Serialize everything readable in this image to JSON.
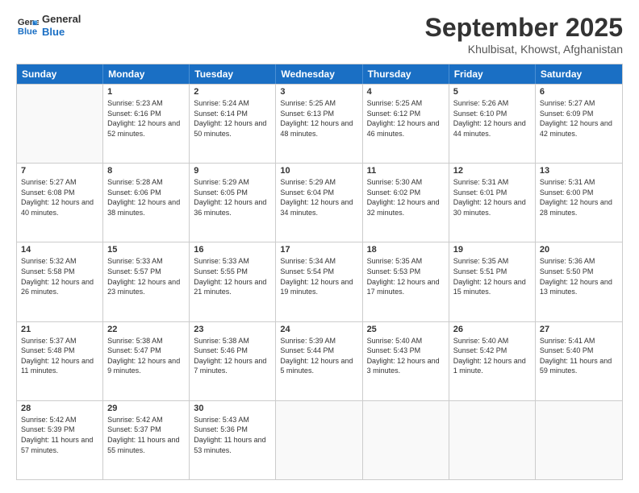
{
  "logo": {
    "line1": "General",
    "line2": "Blue"
  },
  "title": "September 2025",
  "subtitle": "Khulbisat, Khowst, Afghanistan",
  "header_days": [
    "Sunday",
    "Monday",
    "Tuesday",
    "Wednesday",
    "Thursday",
    "Friday",
    "Saturday"
  ],
  "weeks": [
    [
      {
        "day": "",
        "empty": true
      },
      {
        "day": "1",
        "sunrise": "Sunrise: 5:23 AM",
        "sunset": "Sunset: 6:16 PM",
        "daylight": "Daylight: 12 hours and 52 minutes."
      },
      {
        "day": "2",
        "sunrise": "Sunrise: 5:24 AM",
        "sunset": "Sunset: 6:14 PM",
        "daylight": "Daylight: 12 hours and 50 minutes."
      },
      {
        "day": "3",
        "sunrise": "Sunrise: 5:25 AM",
        "sunset": "Sunset: 6:13 PM",
        "daylight": "Daylight: 12 hours and 48 minutes."
      },
      {
        "day": "4",
        "sunrise": "Sunrise: 5:25 AM",
        "sunset": "Sunset: 6:12 PM",
        "daylight": "Daylight: 12 hours and 46 minutes."
      },
      {
        "day": "5",
        "sunrise": "Sunrise: 5:26 AM",
        "sunset": "Sunset: 6:10 PM",
        "daylight": "Daylight: 12 hours and 44 minutes."
      },
      {
        "day": "6",
        "sunrise": "Sunrise: 5:27 AM",
        "sunset": "Sunset: 6:09 PM",
        "daylight": "Daylight: 12 hours and 42 minutes."
      }
    ],
    [
      {
        "day": "7",
        "sunrise": "Sunrise: 5:27 AM",
        "sunset": "Sunset: 6:08 PM",
        "daylight": "Daylight: 12 hours and 40 minutes."
      },
      {
        "day": "8",
        "sunrise": "Sunrise: 5:28 AM",
        "sunset": "Sunset: 6:06 PM",
        "daylight": "Daylight: 12 hours and 38 minutes."
      },
      {
        "day": "9",
        "sunrise": "Sunrise: 5:29 AM",
        "sunset": "Sunset: 6:05 PM",
        "daylight": "Daylight: 12 hours and 36 minutes."
      },
      {
        "day": "10",
        "sunrise": "Sunrise: 5:29 AM",
        "sunset": "Sunset: 6:04 PM",
        "daylight": "Daylight: 12 hours and 34 minutes."
      },
      {
        "day": "11",
        "sunrise": "Sunrise: 5:30 AM",
        "sunset": "Sunset: 6:02 PM",
        "daylight": "Daylight: 12 hours and 32 minutes."
      },
      {
        "day": "12",
        "sunrise": "Sunrise: 5:31 AM",
        "sunset": "Sunset: 6:01 PM",
        "daylight": "Daylight: 12 hours and 30 minutes."
      },
      {
        "day": "13",
        "sunrise": "Sunrise: 5:31 AM",
        "sunset": "Sunset: 6:00 PM",
        "daylight": "Daylight: 12 hours and 28 minutes."
      }
    ],
    [
      {
        "day": "14",
        "sunrise": "Sunrise: 5:32 AM",
        "sunset": "Sunset: 5:58 PM",
        "daylight": "Daylight: 12 hours and 26 minutes."
      },
      {
        "day": "15",
        "sunrise": "Sunrise: 5:33 AM",
        "sunset": "Sunset: 5:57 PM",
        "daylight": "Daylight: 12 hours and 23 minutes."
      },
      {
        "day": "16",
        "sunrise": "Sunrise: 5:33 AM",
        "sunset": "Sunset: 5:55 PM",
        "daylight": "Daylight: 12 hours and 21 minutes."
      },
      {
        "day": "17",
        "sunrise": "Sunrise: 5:34 AM",
        "sunset": "Sunset: 5:54 PM",
        "daylight": "Daylight: 12 hours and 19 minutes."
      },
      {
        "day": "18",
        "sunrise": "Sunrise: 5:35 AM",
        "sunset": "Sunset: 5:53 PM",
        "daylight": "Daylight: 12 hours and 17 minutes."
      },
      {
        "day": "19",
        "sunrise": "Sunrise: 5:35 AM",
        "sunset": "Sunset: 5:51 PM",
        "daylight": "Daylight: 12 hours and 15 minutes."
      },
      {
        "day": "20",
        "sunrise": "Sunrise: 5:36 AM",
        "sunset": "Sunset: 5:50 PM",
        "daylight": "Daylight: 12 hours and 13 minutes."
      }
    ],
    [
      {
        "day": "21",
        "sunrise": "Sunrise: 5:37 AM",
        "sunset": "Sunset: 5:48 PM",
        "daylight": "Daylight: 12 hours and 11 minutes."
      },
      {
        "day": "22",
        "sunrise": "Sunrise: 5:38 AM",
        "sunset": "Sunset: 5:47 PM",
        "daylight": "Daylight: 12 hours and 9 minutes."
      },
      {
        "day": "23",
        "sunrise": "Sunrise: 5:38 AM",
        "sunset": "Sunset: 5:46 PM",
        "daylight": "Daylight: 12 hours and 7 minutes."
      },
      {
        "day": "24",
        "sunrise": "Sunrise: 5:39 AM",
        "sunset": "Sunset: 5:44 PM",
        "daylight": "Daylight: 12 hours and 5 minutes."
      },
      {
        "day": "25",
        "sunrise": "Sunrise: 5:40 AM",
        "sunset": "Sunset: 5:43 PM",
        "daylight": "Daylight: 12 hours and 3 minutes."
      },
      {
        "day": "26",
        "sunrise": "Sunrise: 5:40 AM",
        "sunset": "Sunset: 5:42 PM",
        "daylight": "Daylight: 12 hours and 1 minute."
      },
      {
        "day": "27",
        "sunrise": "Sunrise: 5:41 AM",
        "sunset": "Sunset: 5:40 PM",
        "daylight": "Daylight: 11 hours and 59 minutes."
      }
    ],
    [
      {
        "day": "28",
        "sunrise": "Sunrise: 5:42 AM",
        "sunset": "Sunset: 5:39 PM",
        "daylight": "Daylight: 11 hours and 57 minutes."
      },
      {
        "day": "29",
        "sunrise": "Sunrise: 5:42 AM",
        "sunset": "Sunset: 5:37 PM",
        "daylight": "Daylight: 11 hours and 55 minutes."
      },
      {
        "day": "30",
        "sunrise": "Sunrise: 5:43 AM",
        "sunset": "Sunset: 5:36 PM",
        "daylight": "Daylight: 11 hours and 53 minutes."
      },
      {
        "day": "",
        "empty": true
      },
      {
        "day": "",
        "empty": true
      },
      {
        "day": "",
        "empty": true
      },
      {
        "day": "",
        "empty": true
      }
    ]
  ]
}
